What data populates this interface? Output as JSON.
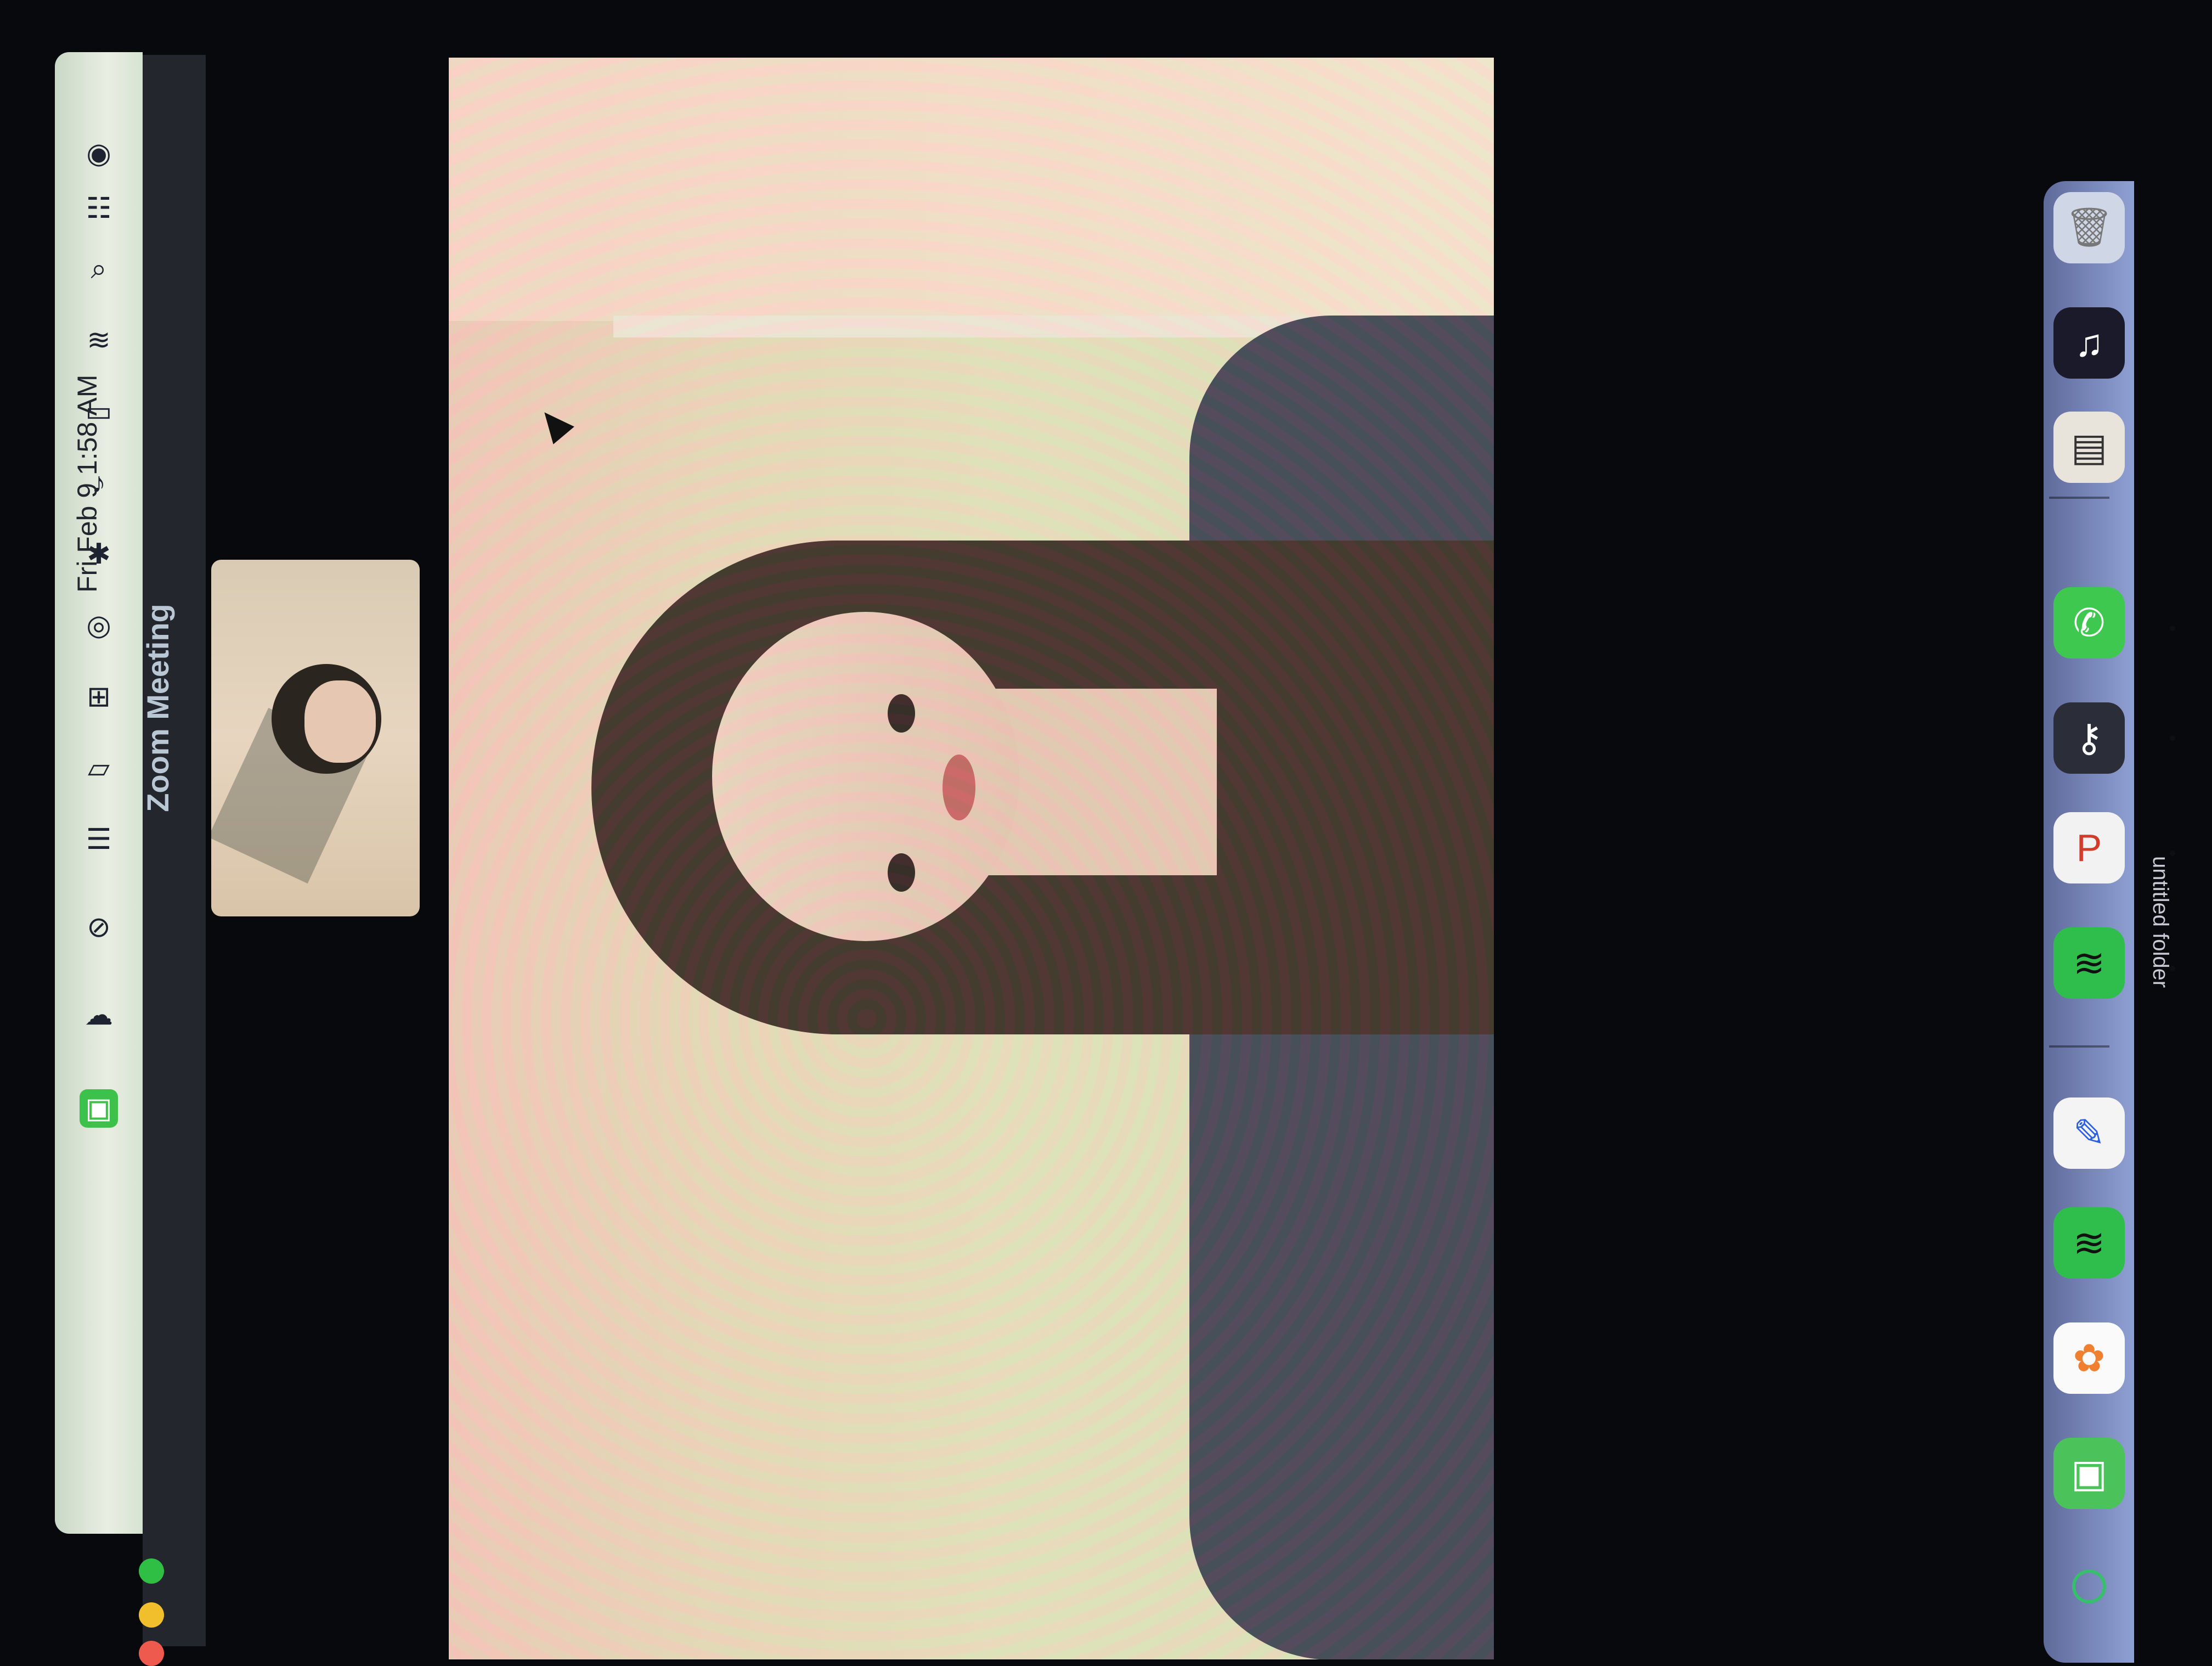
{
  "menubar": {
    "datetime": "Fri Feb 9  1:58 AM",
    "icons": [
      "siri-icon",
      "control-center-icon",
      "spotlight-icon",
      "wifi-icon",
      "battery-icon",
      "sound-icon",
      "bluetooth-icon",
      "screen-record-icon",
      "screen-mirror-icon",
      "display-icon",
      "app-menu-icon",
      "vpn-icon",
      "cloud-icon",
      "zoom-icon"
    ]
  },
  "window": {
    "title": "Zoom Meeting"
  },
  "dock": {
    "apps": [
      "trash",
      "spotify-widget",
      "document",
      "whatsapp",
      "keychain",
      "powerpoint",
      "spotify",
      "freeform",
      "spotify",
      "photos",
      "zoom",
      "activity"
    ],
    "folder_label": "untitled folder"
  },
  "colors": {
    "menubar_bg": "#dde7d9",
    "dock_bg": "#7486bf",
    "title_text": "#b9c6d4",
    "traffic_green": "#2fbf45",
    "traffic_yellow": "#f1bf2c",
    "traffic_red": "#ee5b4e"
  }
}
